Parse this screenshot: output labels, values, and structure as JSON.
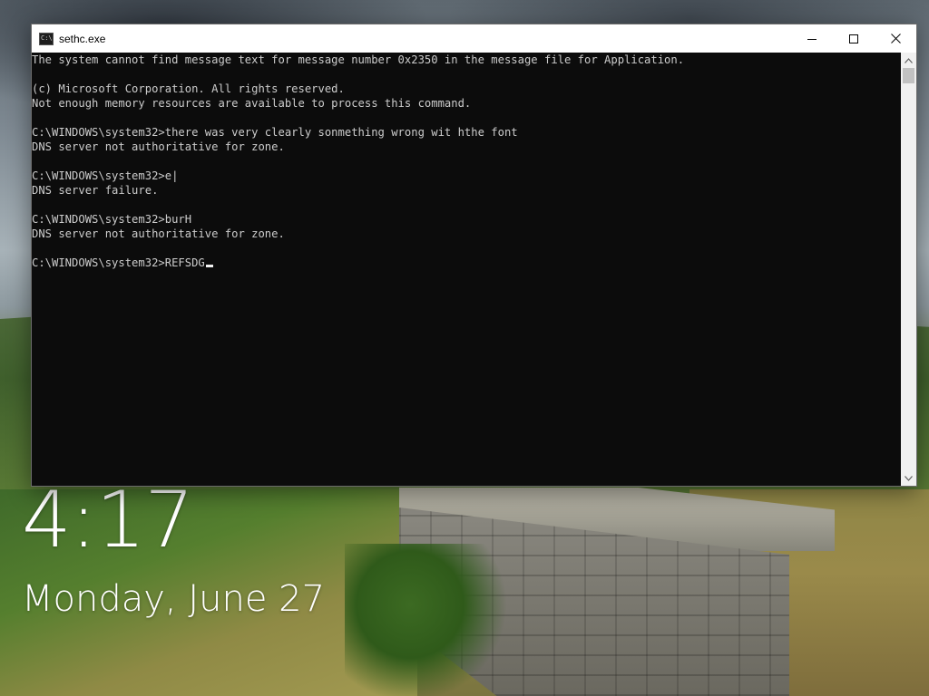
{
  "lock_screen": {
    "time": "4:17",
    "date": "Monday, June 27"
  },
  "window": {
    "title": "sethc.exe",
    "icon": "console-app-icon",
    "controls": {
      "minimize": "minimize-icon",
      "maximize": "maximize-icon",
      "close": "close-icon"
    }
  },
  "console": {
    "lines": [
      "The system cannot find message text for message number 0x2350 in the message file for Application.",
      "",
      "(c) Microsoft Corporation. All rights reserved.",
      "Not enough memory resources are available to process this command.",
      "",
      "C:\\WINDOWS\\system32>there was very clearly sonmething wrong wit hthe font",
      "DNS server not authoritative for zone.",
      "",
      "C:\\WINDOWS\\system32>e|",
      "DNS server failure.",
      "",
      "C:\\WINDOWS\\system32>burH",
      "DNS server not authoritative for zone.",
      "",
      "C:\\WINDOWS\\system32>REFSDG"
    ]
  },
  "colors": {
    "console_bg": "#0c0c0c",
    "console_fg": "#cccccc",
    "titlebar_bg": "#ffffff"
  }
}
